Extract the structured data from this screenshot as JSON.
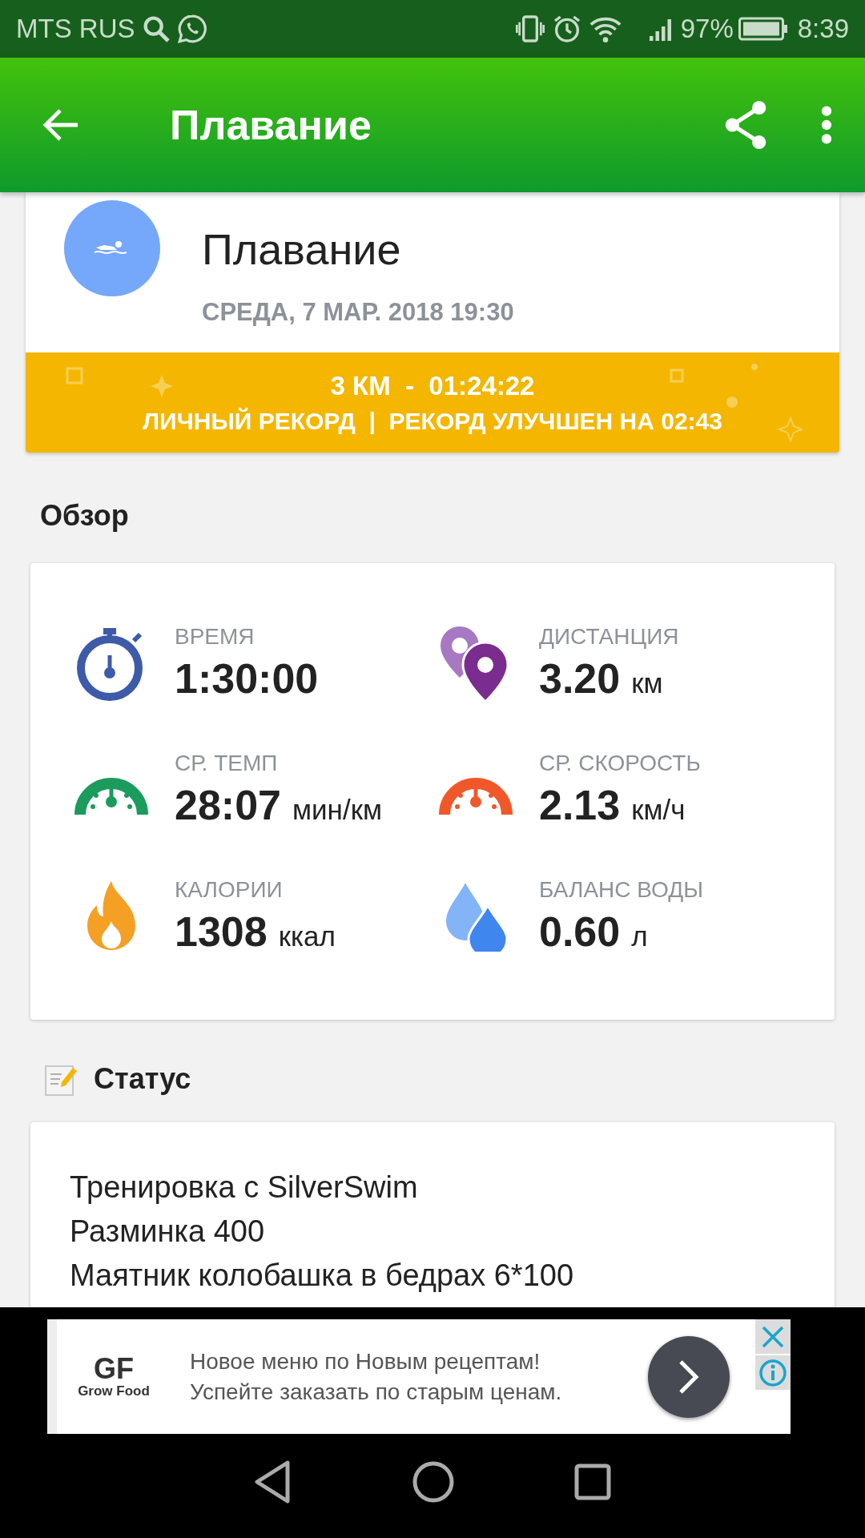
{
  "status_bar": {
    "carrier": "MTS RUS",
    "battery": "97%",
    "time": "8:39"
  },
  "app_bar": {
    "title": "Плавание"
  },
  "activity": {
    "title": "Плавание",
    "date": "СРЕДА, 7 МАР. 2018 19:30",
    "record_line": "3 КМ  -  01:24:22",
    "record_note": "ЛИЧНЫЙ РЕКОРД  |  РЕКОРД УЛУЧШЕН НА 02:43"
  },
  "overview": {
    "heading": "Обзор",
    "metrics": [
      {
        "kind": "time",
        "label": "ВРЕМЯ",
        "value": "1:30:00"
      },
      {
        "kind": "distance",
        "label": "ДИСТАНЦИЯ",
        "value": "3.20",
        "unit": "км"
      },
      {
        "kind": "pace",
        "label": "СР. ТЕМП",
        "value": "28:07",
        "unit": "мин/км"
      },
      {
        "kind": "speed",
        "label": "СР. СКОРОСТЬ",
        "value": "2.13",
        "unit": "км/ч"
      },
      {
        "kind": "calories",
        "label": "КАЛОРИИ",
        "value": "1308",
        "unit": "ккал"
      },
      {
        "kind": "water",
        "label": "БАЛАНС ВОДЫ",
        "value": "0.60",
        "unit": "л"
      }
    ]
  },
  "status": {
    "heading": "Статус",
    "lines": [
      "Тренировка с SilverSwim",
      "Разминка 400",
      "Маятник колобашка в бедрах 6*100"
    ]
  },
  "ad": {
    "logo": "GF",
    "brand": "Grow Food",
    "lines": [
      "Новое меню по Новым рецептам!",
      "Успейте заказать по старым ценам."
    ]
  }
}
